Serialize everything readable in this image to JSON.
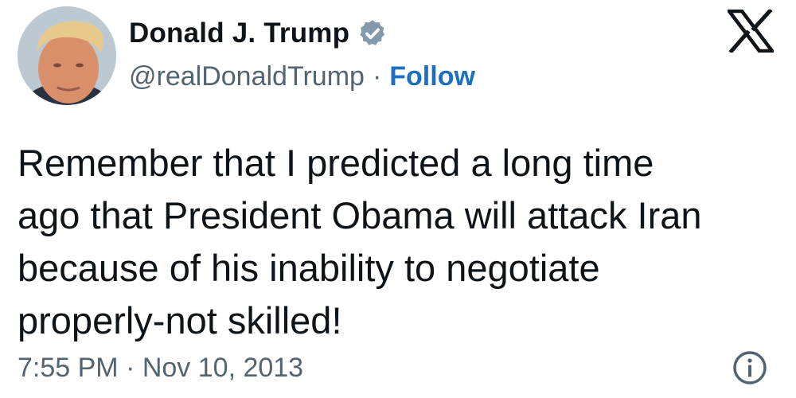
{
  "author": {
    "display_name": "Donald J. Trump",
    "handle": "@realDonaldTrump",
    "separator": "·",
    "follow_label": "Follow",
    "verified": true,
    "avatar_icon": "profile-photo"
  },
  "tweet": {
    "text": "Remember that I predicted a long time\nago that President Obama will attack Iran\nbecause of his inability to negotiate\nproperly-not skilled!"
  },
  "meta": {
    "timestamp": "7:55 PM · Nov 10, 2013"
  },
  "icons": {
    "brand": "x-logo-icon",
    "badge": "verified-badge-icon",
    "info": "info-icon"
  },
  "colors": {
    "text": "#0f1419",
    "secondary": "#536471",
    "follow": "#1d6fc0",
    "badge": "#829aab"
  }
}
